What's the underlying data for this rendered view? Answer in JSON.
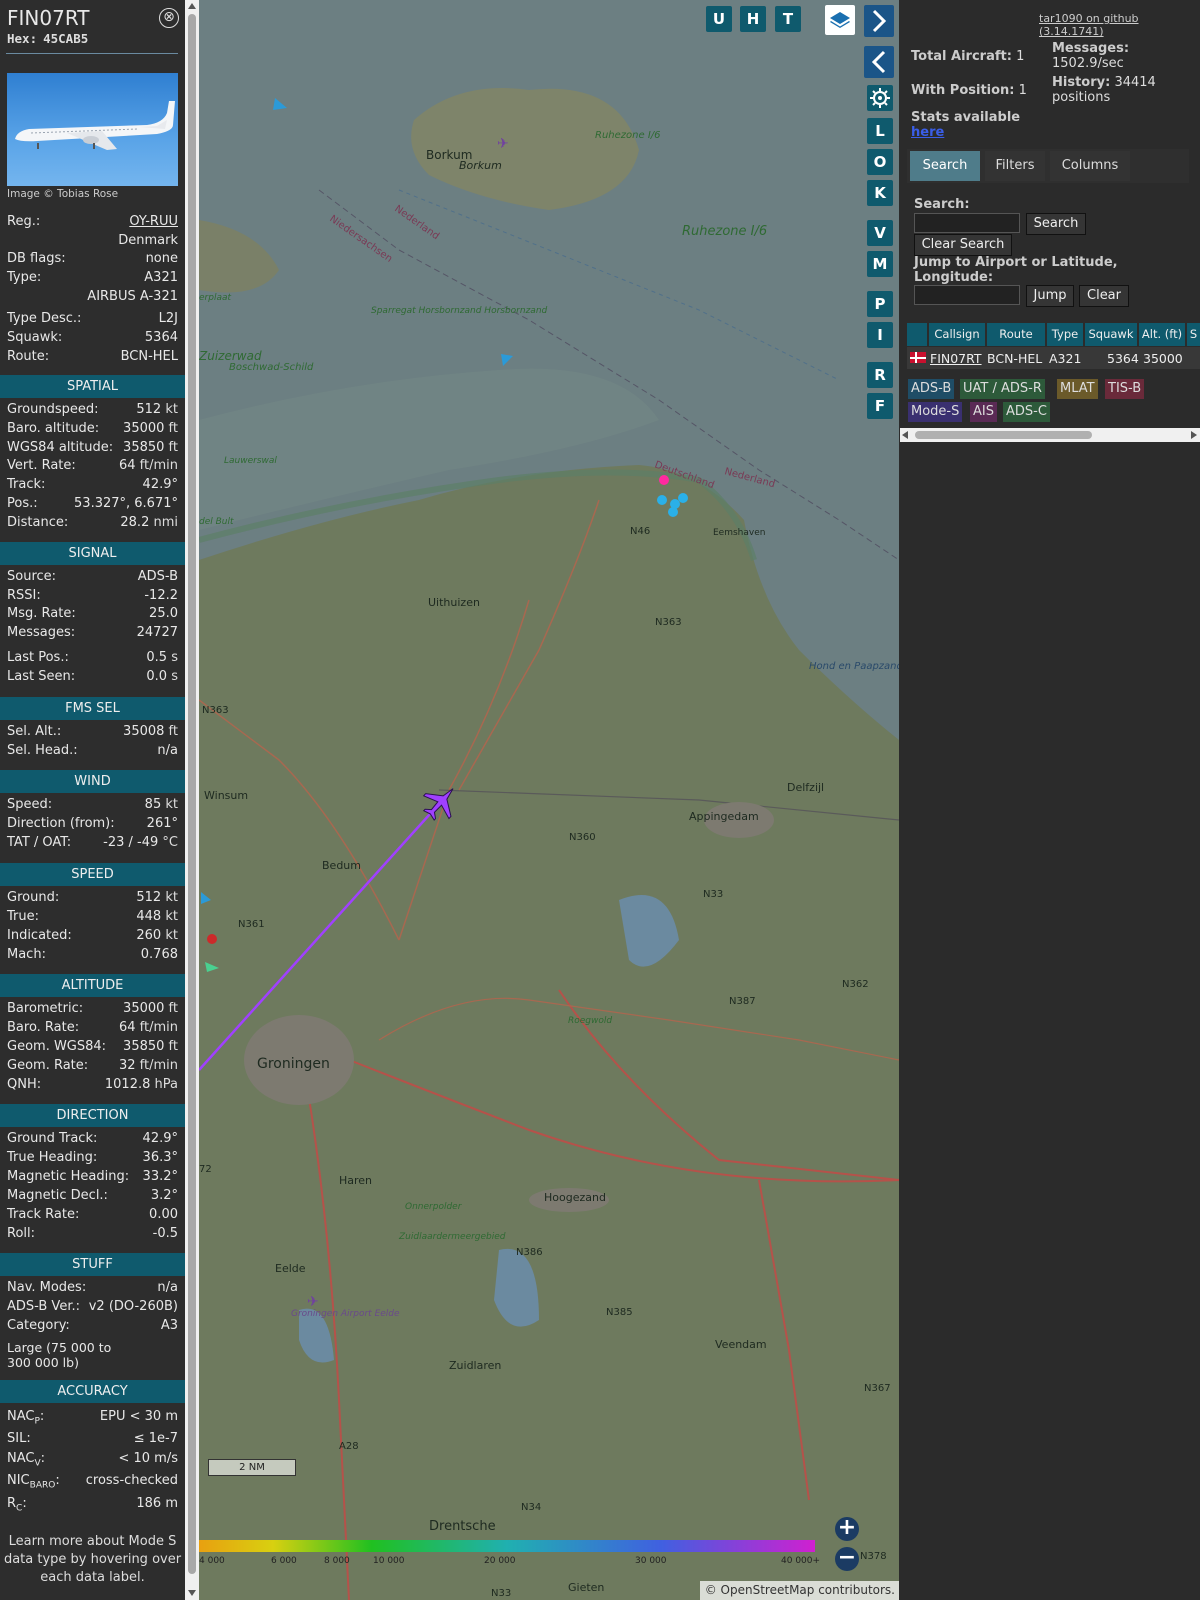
{
  "aircraft": {
    "callsign": "FIN07RT",
    "hex_label": "Hex:",
    "hex": "45CAB5",
    "photo_credit": "Image © Tobias Rose",
    "close_symbol": "⊗"
  },
  "info_top": [
    {
      "k": "Reg.:",
      "v": "OY-RUU"
    },
    {
      "k": "",
      "v": "Denmark"
    },
    {
      "k": "DB flags:",
      "v": "none"
    },
    {
      "k": "Type:",
      "v": "A321"
    },
    {
      "k": "",
      "v": "AIRBUS A-321"
    },
    {
      "k": "Type Desc.:",
      "v": "L2J"
    },
    {
      "k": "Squawk:",
      "v": "5364"
    },
    {
      "k": "Route:",
      "v": "BCN-HEL"
    }
  ],
  "sections": {
    "spatial": {
      "title": "SPATIAL",
      "rows": [
        {
          "k": "Groundspeed:",
          "v": "512",
          "u": "kt"
        },
        {
          "k": "Baro. altitude:",
          "v": "35000",
          "u": "ft"
        },
        {
          "k": "WGS84 altitude:",
          "v": "35850",
          "u": "ft"
        },
        {
          "k": "Vert. Rate:",
          "v": "64",
          "u": "ft/min"
        },
        {
          "k": "Track:",
          "v": "42.9°",
          "u": ""
        },
        {
          "k": "Pos.:",
          "v": "53.327°, 6.671°",
          "u": ""
        },
        {
          "k": "Distance:",
          "v": "28.2",
          "u": "nmi"
        }
      ]
    },
    "signal": {
      "title": "SIGNAL",
      "rows": [
        {
          "k": "Source:",
          "v": "ADS-B",
          "u": ""
        },
        {
          "k": "RSSI:",
          "v": "-12.2",
          "u": ""
        },
        {
          "k": "Msg. Rate:",
          "v": "25.0",
          "u": ""
        },
        {
          "k": "Messages:",
          "v": "24727",
          "u": ""
        },
        {
          "k": "Last Pos.:",
          "v": "0.5",
          "u": "s"
        },
        {
          "k": "Last Seen:",
          "v": "0.0",
          "u": "s"
        }
      ]
    },
    "fms": {
      "title": "FMS SEL",
      "rows": [
        {
          "k": "Sel. Alt.:",
          "v": "35008",
          "u": "ft"
        },
        {
          "k": "Sel. Head.:",
          "v": "n/a",
          "u": ""
        }
      ]
    },
    "wind": {
      "title": "WIND",
      "rows": [
        {
          "k": "Speed:",
          "v": "85",
          "u": "kt"
        },
        {
          "k": "Direction (from):",
          "v": "261°",
          "u": ""
        },
        {
          "k": "TAT / OAT:",
          "v": "-23 / -49",
          "u": "°C"
        }
      ]
    },
    "speed": {
      "title": "SPEED",
      "rows": [
        {
          "k": "Ground:",
          "v": "512",
          "u": "kt"
        },
        {
          "k": "True:",
          "v": "448",
          "u": "kt"
        },
        {
          "k": "Indicated:",
          "v": "260",
          "u": "kt"
        },
        {
          "k": "Mach:",
          "v": "0.768",
          "u": ""
        }
      ]
    },
    "altitude": {
      "title": "ALTITUDE",
      "rows": [
        {
          "k": "Barometric:",
          "v": "35000",
          "u": "ft"
        },
        {
          "k": "Baro. Rate:",
          "v": "64",
          "u": "ft/min"
        },
        {
          "k": "Geom. WGS84:",
          "v": "35850",
          "u": "ft"
        },
        {
          "k": "Geom. Rate:",
          "v": "32",
          "u": "ft/min"
        },
        {
          "k": "QNH:",
          "v": "1012.8",
          "u": "hPa"
        }
      ]
    },
    "direction": {
      "title": "DIRECTION",
      "rows": [
        {
          "k": "Ground Track:",
          "v": "42.9°",
          "u": ""
        },
        {
          "k": "True Heading:",
          "v": "36.3°",
          "u": ""
        },
        {
          "k": "Magnetic Heading:",
          "v": "33.2°",
          "u": ""
        },
        {
          "k": "Magnetic Decl.:",
          "v": "3.2°",
          "u": ""
        },
        {
          "k": "Track Rate:",
          "v": "0.00",
          "u": ""
        },
        {
          "k": "Roll:",
          "v": "-0.5",
          "u": ""
        }
      ]
    },
    "stuff": {
      "title": "STUFF",
      "rows": [
        {
          "k": "Nav. Modes:",
          "v": "n/a",
          "u": ""
        },
        {
          "k": "ADS-B Ver.:",
          "v": "v2 (DO-260B)",
          "u": ""
        },
        {
          "k": "Category:",
          "v": "A3",
          "u": ""
        }
      ],
      "category_desc": "Large (75 000 to 300 000 lb)"
    },
    "accuracy": {
      "title": "ACCURACY",
      "rows": [
        {
          "k": "NAC",
          "sub": "P",
          "v": "EPU < 30 m"
        },
        {
          "k": "SIL:",
          "sub": "",
          "v": "≤ 1e-7"
        },
        {
          "k": "NAC",
          "sub": "V",
          "v": "< 10 m/s"
        },
        {
          "k": "NIC",
          "sub": "BARO",
          "v": "cross-checked"
        },
        {
          "k": "R",
          "sub": "C",
          "v": "186 m"
        }
      ]
    }
  },
  "footnote": "Learn more about Mode S data type by hovering over each data label.",
  "map": {
    "top_buttons": [
      "U",
      "H",
      "T"
    ],
    "side_buttons": [
      "L",
      "O",
      "K",
      "V",
      "M",
      "P",
      "I",
      "R",
      "F"
    ],
    "places": [
      "Borkum",
      "Borkum",
      "Ruhezone I/6",
      "Ruhezone I/6",
      "Niedersachsen",
      "Nederland",
      "Sparregat Horsbornzand Horsbornzand",
      "Boschwad-Schild",
      "Zuizerwad",
      "erplaat",
      "Lauwerswal",
      "del Bult",
      "Deutschland",
      "Nederland",
      "Eemshaven",
      "N46",
      "Uithuizen",
      "N363",
      "N363",
      "Hond en Paapzand / Hund und Paapsand",
      "Winsum",
      "Delfzijl",
      "Appingedam",
      "N360",
      "Bedum",
      "N33",
      "N361",
      "N362",
      "N387",
      "Roegwold",
      "Groningen",
      "Haren",
      "Hoogezand",
      "Onnerpolder",
      "Zuidlaardermeergebied",
      "N386",
      "Eelde",
      "Groningen Airport Eelde",
      "N385",
      "Veendam",
      "Zuidlaren",
      "N367",
      "A28",
      "N34",
      "Drentsche",
      "N33",
      "Gieten",
      "N378",
      "72"
    ],
    "color_scale": [
      "4 000",
      "6 000",
      "8 000",
      "10 000",
      "20 000",
      "30 000",
      "40 000+"
    ],
    "scale_label": "2 NM",
    "attribution": "© OpenStreetMap contributors.",
    "zoom_in": "+",
    "zoom_out": "−"
  },
  "right": {
    "version_link": "tar1090 on github (3.14.1741)",
    "total_aircraft_label": "Total Aircraft:",
    "total_aircraft": "1",
    "with_position_label": "With Position:",
    "with_position": "1",
    "messages_label": "Messages:",
    "messages_value": "1502.9/sec",
    "history_label": "History:",
    "history_value": "34414 positions",
    "stats_label": "Stats available",
    "stats_link": "here",
    "tabs": [
      "Search",
      "Filters",
      "Columns"
    ],
    "search_label": "Search:",
    "search_button": "Search",
    "clear_search_button": "Clear Search",
    "jump_label": "Jump to Airport or Latitude, Longitude:",
    "jump_button": "Jump",
    "clear_button": "Clear",
    "table_headers": [
      "",
      "Callsign",
      "Route",
      "Type",
      "Squawk",
      "Alt. (ft)",
      "S"
    ],
    "table_rows": [
      {
        "callsign": "FIN07RT",
        "route": "BCN-HEL",
        "type": "A321",
        "squawk": "5364",
        "alt": "35000"
      }
    ],
    "source_tags": [
      {
        "label": "ADS-B",
        "color": "#1f4d66"
      },
      {
        "label": "UAT / ADS-R",
        "color": "#2d5a3a"
      },
      {
        "label": "MLAT",
        "color": "#6b5a2a"
      },
      {
        "label": "TIS-B",
        "color": "#6a2a3a"
      },
      {
        "label": "Mode-S",
        "color": "#3a3070"
      },
      {
        "label": "AIS",
        "color": "#5a2a55"
      },
      {
        "label": "ADS-C",
        "color": "#2d5a3a"
      }
    ]
  },
  "colors": {
    "section_header": "#0f5a6d",
    "track_line": "#a040ff",
    "aircraft_icon": "#a040ff",
    "panel_bg": "#2d2d2d"
  }
}
